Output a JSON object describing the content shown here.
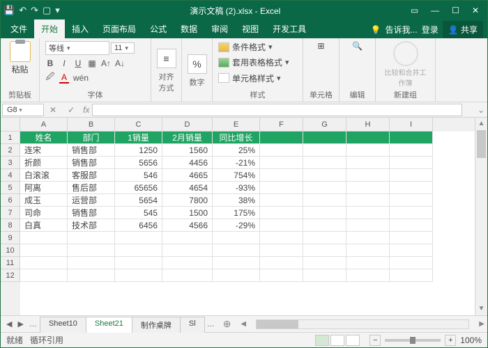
{
  "title": "演示文稿 (2).xlsx - Excel",
  "tabs": [
    "文件",
    "开始",
    "插入",
    "页面布局",
    "公式",
    "数据",
    "审阅",
    "视图",
    "开发工具"
  ],
  "tell_me": "告诉我...",
  "login": "登录",
  "share": "共享",
  "ribbon": {
    "paste": "粘贴",
    "clipboard": "剪贴板",
    "font_name": "等线",
    "font_size": "11",
    "font_grp": "字体",
    "align": "对齐方式",
    "number": "数字",
    "cond_fmt": "条件格式",
    "table_fmt": "套用表格格式",
    "cell_fmt": "单元格样式",
    "styles": "样式",
    "cells": "单元格",
    "edit": "编辑",
    "compare": "比较和合并工作簿",
    "newgrp": "新建组"
  },
  "namebox": "G8",
  "cols": [
    "A",
    "B",
    "C",
    "D",
    "E",
    "F",
    "G",
    "H",
    "I"
  ],
  "headers": [
    "姓名",
    "部门",
    "1销量",
    "2月销量",
    "同比增长"
  ],
  "data": [
    [
      "连宋",
      "销售部",
      "1250",
      "1560",
      "25%"
    ],
    [
      "折颜",
      "销售部",
      "5656",
      "4456",
      "-21%"
    ],
    [
      "白滚滚",
      "客服部",
      "546",
      "4665",
      "754%"
    ],
    [
      "阿离",
      "售后部",
      "65656",
      "4654",
      "-93%"
    ],
    [
      "成玉",
      "运营部",
      "5654",
      "7800",
      "38%"
    ],
    [
      "司命",
      "销售部",
      "545",
      "1500",
      "175%"
    ],
    [
      "白真",
      "技术部",
      "6456",
      "4566",
      "-29%"
    ]
  ],
  "sheets": [
    "Sheet10",
    "Sheet21",
    "制作桌牌",
    "Sl"
  ],
  "active_sheet": 1,
  "status": {
    "ready": "就绪",
    "circ": "循环引用",
    "zoom": "100%"
  }
}
